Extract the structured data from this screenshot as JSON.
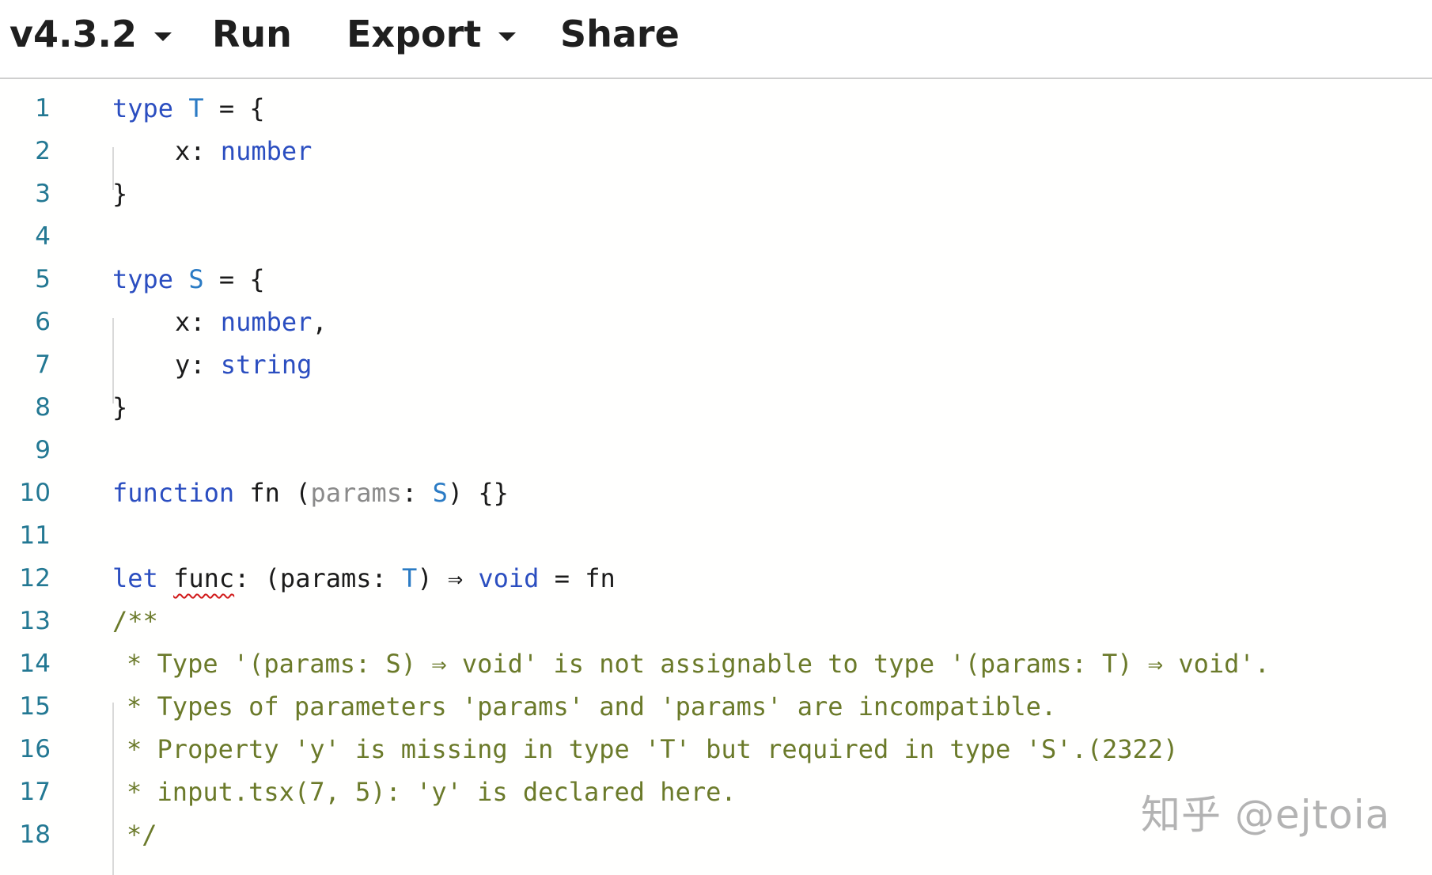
{
  "toolbar": {
    "version_label": "v4.3.2",
    "run_label": "Run",
    "export_label": "Export",
    "share_label": "Share"
  },
  "editor": {
    "lines": [
      {
        "num": "1",
        "tokens": [
          {
            "t": "type",
            "c": "kw"
          },
          {
            "t": " "
          },
          {
            "t": "T",
            "c": "ty"
          },
          {
            "t": " = {"
          }
        ]
      },
      {
        "num": "2",
        "tokens": [
          {
            "t": "x: "
          },
          {
            "t": "number",
            "c": "kw"
          }
        ]
      },
      {
        "num": "3",
        "tokens": [
          {
            "t": "}"
          }
        ]
      },
      {
        "num": "4",
        "tokens": []
      },
      {
        "num": "5",
        "tokens": [
          {
            "t": "type",
            "c": "kw"
          },
          {
            "t": " "
          },
          {
            "t": "S",
            "c": "ty"
          },
          {
            "t": " = {"
          }
        ]
      },
      {
        "num": "6",
        "tokens": [
          {
            "t": "x: "
          },
          {
            "t": "number",
            "c": "kw"
          },
          {
            "t": ","
          }
        ]
      },
      {
        "num": "7",
        "tokens": [
          {
            "t": "y: "
          },
          {
            "t": "string",
            "c": "kw"
          }
        ]
      },
      {
        "num": "8",
        "tokens": [
          {
            "t": "}"
          }
        ]
      },
      {
        "num": "9",
        "tokens": []
      },
      {
        "num": "10",
        "tokens": [
          {
            "t": "function",
            "c": "kw"
          },
          {
            "t": " fn ("
          },
          {
            "t": "params",
            "c": "pm"
          },
          {
            "t": ": "
          },
          {
            "t": "S",
            "c": "ty"
          },
          {
            "t": ") {}"
          }
        ]
      },
      {
        "num": "11",
        "tokens": []
      },
      {
        "num": "12",
        "tokens": [
          {
            "t": "let",
            "c": "kw"
          },
          {
            "t": " "
          },
          {
            "t": "func",
            "c": "squiggle"
          },
          {
            "t": ": (params: "
          },
          {
            "t": "T",
            "c": "ty"
          },
          {
            "t": ") ⇒ "
          },
          {
            "t": "void",
            "c": "kw"
          },
          {
            "t": " = fn"
          }
        ]
      },
      {
        "num": "13",
        "tokens": [
          {
            "t": "/**",
            "c": "cm"
          }
        ]
      },
      {
        "num": "14",
        "tokens": [
          {
            "t": "* Type '(params: S) ⇒ void' is not assignable to type '(params: T) ⇒ void'.",
            "c": "cm"
          }
        ]
      },
      {
        "num": "15",
        "tokens": [
          {
            "t": "* Types of parameters 'params' and 'params' are incompatible.",
            "c": "cm"
          }
        ]
      },
      {
        "num": "16",
        "tokens": [
          {
            "t": "* Property 'y' is missing in type 'T' but required in type 'S'.(2322)",
            "c": "cm"
          }
        ]
      },
      {
        "num": "17",
        "tokens": [
          {
            "t": "* input.tsx(7, 5): 'y' is declared here.",
            "c": "cm"
          }
        ]
      },
      {
        "num": "18",
        "tokens": [
          {
            "t": "*/",
            "c": "cm"
          }
        ]
      }
    ]
  },
  "watermark": {
    "text": "知乎 @ejtoia"
  }
}
